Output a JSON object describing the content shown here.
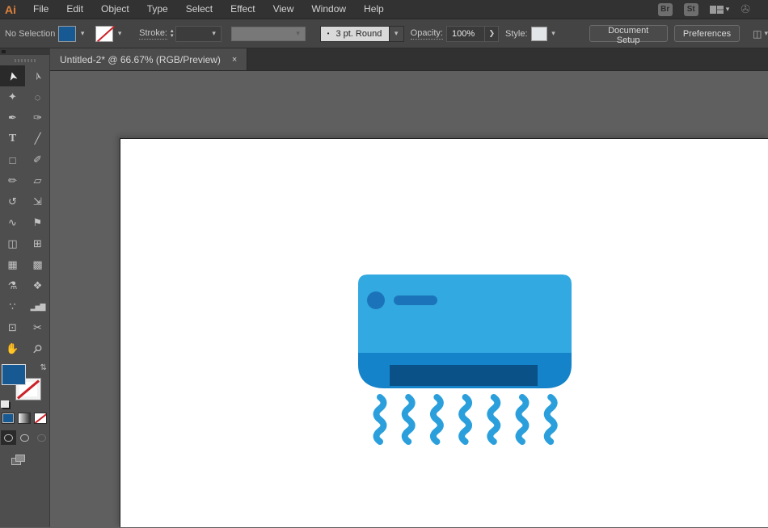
{
  "app": {
    "logo": "Ai",
    "menus": [
      "File",
      "Edit",
      "Object",
      "Type",
      "Select",
      "Effect",
      "View",
      "Window",
      "Help"
    ],
    "bridge_label": "Br",
    "stock_label": "St"
  },
  "control_bar": {
    "selection_status": "No Selection",
    "stroke_label": "Stroke:",
    "stepper_up": "▴",
    "stepper_down": "▾",
    "brush_bullet": "•",
    "brush_value": "3 pt. Round",
    "opacity_label": "Opacity:",
    "opacity_value": "100%",
    "opacity_expand": "❯",
    "style_label": "Style:",
    "document_setup_label": "Document Setup",
    "preferences_label": "Preferences",
    "chevron": "▾"
  },
  "document_tab": {
    "title": "Untitled-2* @ 66.67% (RGB/Preview)",
    "close": "×"
  },
  "toolbar": {
    "tools": [
      {
        "name": "selection",
        "glyph": "➤",
        "selected": true
      },
      {
        "name": "direct-selection",
        "glyph": "➢"
      },
      {
        "name": "magic-wand",
        "glyph": "✦"
      },
      {
        "name": "lasso",
        "glyph": "◌"
      },
      {
        "name": "pen",
        "glyph": "✒"
      },
      {
        "name": "curvature",
        "glyph": "✑"
      },
      {
        "name": "type",
        "glyph": "T"
      },
      {
        "name": "line",
        "glyph": "╱"
      },
      {
        "name": "rectangle",
        "glyph": "□"
      },
      {
        "name": "paintbrush",
        "glyph": "✐"
      },
      {
        "name": "shaper",
        "glyph": "✏"
      },
      {
        "name": "eraser",
        "glyph": "▱"
      },
      {
        "name": "rotate",
        "glyph": "↺"
      },
      {
        "name": "scale",
        "glyph": "⇲"
      },
      {
        "name": "width",
        "glyph": "∿"
      },
      {
        "name": "puppet-warp",
        "glyph": "⚑"
      },
      {
        "name": "shape-builder",
        "glyph": "◫"
      },
      {
        "name": "perspective-grid",
        "glyph": "⊞"
      },
      {
        "name": "mesh",
        "glyph": "▦"
      },
      {
        "name": "gradient",
        "glyph": "▩"
      },
      {
        "name": "eyedropper",
        "glyph": "⚗"
      },
      {
        "name": "blend",
        "glyph": "❖"
      },
      {
        "name": "symbol-sprayer",
        "glyph": "∵"
      },
      {
        "name": "column-graph",
        "glyph": "▂▅▇"
      },
      {
        "name": "artboard",
        "glyph": "⊡"
      },
      {
        "name": "slice",
        "glyph": "✂"
      },
      {
        "name": "hand",
        "glyph": "✋"
      },
      {
        "name": "zoom",
        "glyph": "⚲"
      }
    ],
    "swap_icon": "⇄"
  },
  "colors": {
    "fill_swatch": "#175A93",
    "canvas_gray": "#5F5F5F",
    "artboard_white": "#FFFFFF"
  },
  "artwork": {
    "type": "air-conditioner-flat-icon",
    "body_color": "#33A9E1",
    "band_color": "#1583CA",
    "vent_color": "#0A5187",
    "detail_color": "#1B74B9",
    "airflow_color": "#2B9FDC",
    "airflow_lines": 7
  }
}
